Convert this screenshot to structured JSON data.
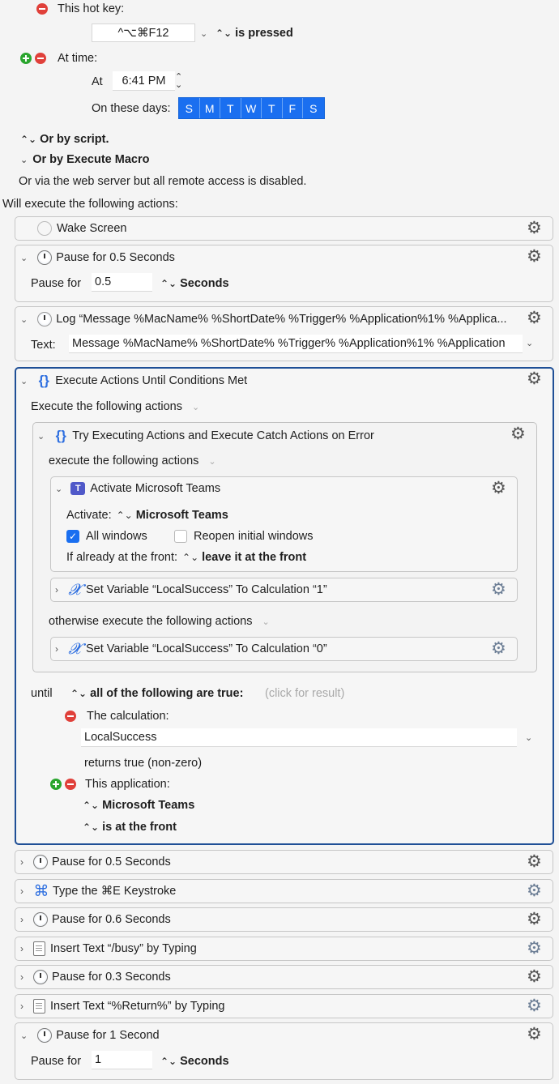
{
  "trigger": {
    "hotkey_label": "This hot key:",
    "hotkey_value": "^⌥⌘F12",
    "hotkey_condition": "is pressed",
    "time_label": "At time:",
    "at_label": "At",
    "time_value": "6:41 PM",
    "days_label": "On these days:",
    "days": [
      "S",
      "M",
      "T",
      "W",
      "T",
      "F",
      "S"
    ],
    "or_script": "Or by script.",
    "or_macro": "Or by Execute Macro",
    "web_server": "Or via the web server but all remote access is disabled.",
    "will_execute": "Will execute the following actions:"
  },
  "actions": {
    "wake_screen": "Wake Screen",
    "pause1_title": "Pause for 0.5 Seconds",
    "pause_for_label": "Pause for",
    "pause1_value": "0.5",
    "seconds_label": "Seconds",
    "log_title": "Log “Message %MacName% %ShortDate% %Trigger% %Application%1% %Applica...",
    "text_label": "Text:",
    "log_text": "Message %MacName% %ShortDate% %Trigger% %Application%1% %Application",
    "until_title": "Execute Actions Until Conditions Met",
    "execute_following": "Execute the following actions",
    "try_title": "Try Executing Actions and Execute Catch Actions on Error",
    "try_execute": "execute the following actions",
    "activate_title": "Activate Microsoft Teams",
    "activate_label": "Activate:",
    "activate_app": "Microsoft Teams",
    "all_windows": "All windows",
    "reopen_windows": "Reopen initial windows",
    "if_front_label": "If already at the front:",
    "if_front_value": "leave it at the front",
    "setvar1_title": "Set Variable “LocalSuccess” To Calculation “1”",
    "otherwise": "otherwise execute the following actions",
    "setvar0_title": "Set Variable “LocalSuccess” To Calculation “0”",
    "until_label": "until",
    "all_true": "all of the following are true:",
    "click_result": "(click for result)",
    "calculation_label": "The calculation:",
    "calculation_value": "LocalSuccess",
    "returns_true": "returns true (non-zero)",
    "this_app_label": "This application:",
    "this_app_value": "Microsoft Teams",
    "is_front": "is at the front",
    "pause2_title": "Pause for 0.5 Seconds",
    "keystroke_title": "Type the ⌘E Keystroke",
    "pause3_title": "Pause for 0.6 Seconds",
    "insert_busy_title": "Insert Text “/busy” by Typing",
    "pause4_title": "Pause for 0.3 Seconds",
    "insert_return_title": "Insert Text “%Return%” by Typing",
    "pause5_title": "Pause for 1 Second",
    "pause5_value": "1"
  }
}
